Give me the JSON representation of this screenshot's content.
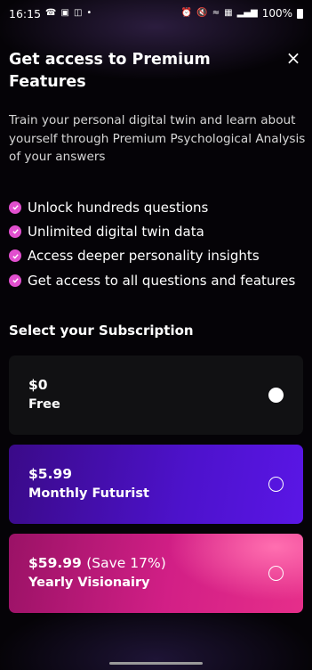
{
  "status_bar": {
    "time": "16:15",
    "left_icons": [
      "whatsapp-icon",
      "image-icon",
      "message-icon",
      "dot-icon"
    ],
    "right_icons": [
      "alarm-icon",
      "mute-icon",
      "wifi-icon",
      "volte-icon",
      "signal-icon"
    ],
    "battery": "100%"
  },
  "header": {
    "title": "Get access to Premium Features",
    "close_label": "×"
  },
  "description": "Train your personal digital twin and learn about yourself through Premium Psychological Analysis of your answers",
  "features": [
    "Unlock hundreds questions",
    "Unlimited digital twin data",
    "Access deeper personality insights",
    "Get access to all questions and features"
  ],
  "subscription": {
    "title": "Select your Subscription",
    "plans": [
      {
        "price": "$0",
        "save": "",
        "name": "Free",
        "selected": true
      },
      {
        "price": "$5.99",
        "save": "",
        "name": "Monthly Futurist",
        "selected": false
      },
      {
        "price": "$59.99",
        "save": "(Save 17%)",
        "name": "Yearly Visionairy",
        "selected": false
      }
    ]
  },
  "colors": {
    "background": "#050307",
    "check": "#e14fce",
    "monthly": "#4d12cc",
    "yearly": "#d21f86",
    "free_card": "#111113"
  }
}
